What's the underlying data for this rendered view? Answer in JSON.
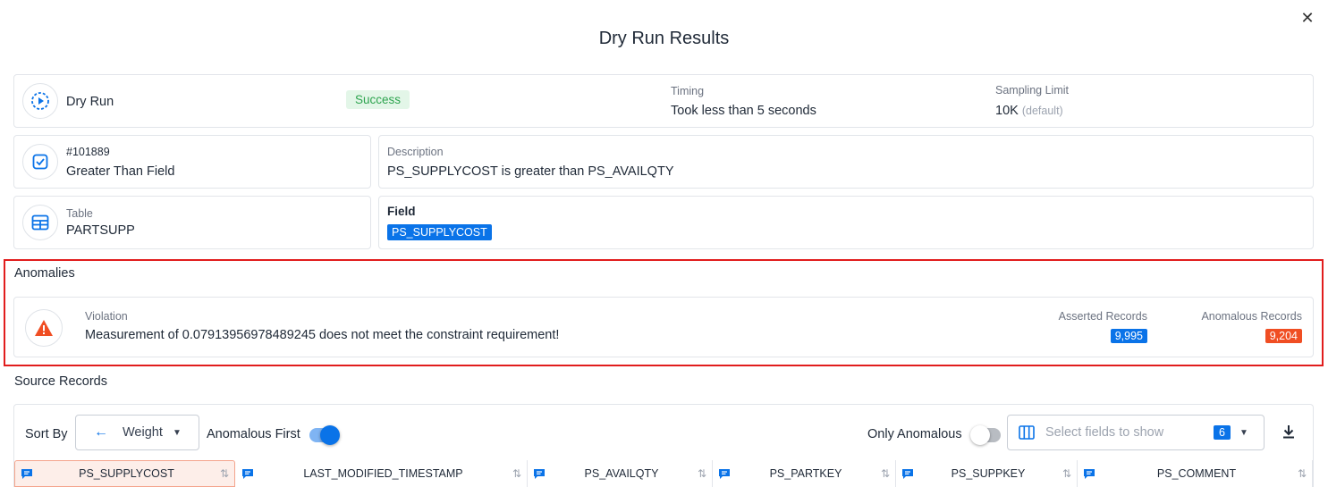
{
  "dialog": {
    "title": "Dry Run Results"
  },
  "summary": {
    "label": "Dry Run",
    "status": "Success",
    "timing_label": "Timing",
    "timing_value": "Took less than 5 seconds",
    "sampling_label": "Sampling Limit",
    "sampling_value": "10K",
    "sampling_note": "(default)"
  },
  "check": {
    "id": "#101889",
    "rule": "Greater Than Field"
  },
  "description": {
    "label": "Description",
    "value": "PS_SUPPLYCOST is greater than PS_AVAILQTY"
  },
  "table": {
    "label": "Table",
    "value": "PARTSUPP"
  },
  "field": {
    "label": "Field",
    "value": "PS_SUPPLYCOST"
  },
  "anomalies": {
    "title": "Anomalies",
    "violation_label": "Violation",
    "violation_text": "Measurement of 0.07913956978489245 does not meet the constraint requirement!",
    "asserted_label": "Asserted Records",
    "asserted_value": "9,995",
    "anomalous_label": "Anomalous Records",
    "anomalous_value": "9,204"
  },
  "source_records": {
    "title": "Source Records",
    "sort_by_label": "Sort By",
    "sort_value": "Weight",
    "anomalous_first_label": "Anomalous First",
    "anomalous_first_on": true,
    "only_anomalous_label": "Only Anomalous",
    "only_anomalous_on": false,
    "fields_placeholder": "Select fields to show",
    "fields_count": "6",
    "columns": [
      "PS_SUPPLYCOST",
      "LAST_MODIFIED_TIMESTAMP",
      "PS_AVAILQTY",
      "PS_PARTKEY",
      "PS_SUPPKEY",
      "PS_COMMENT"
    ]
  },
  "colors": {
    "accent": "#0a73e8",
    "success_bg": "#e3f6e8",
    "success_fg": "#2ea44f",
    "danger": "#f04e23",
    "highlight": "#e11d1d"
  },
  "icons": [
    "close-icon",
    "play-circle-icon",
    "checklist-icon",
    "table-icon",
    "warning-icon",
    "arrow-left-icon",
    "caret-down-icon",
    "columns-icon",
    "download-icon",
    "comment-icon",
    "sort-icon"
  ]
}
